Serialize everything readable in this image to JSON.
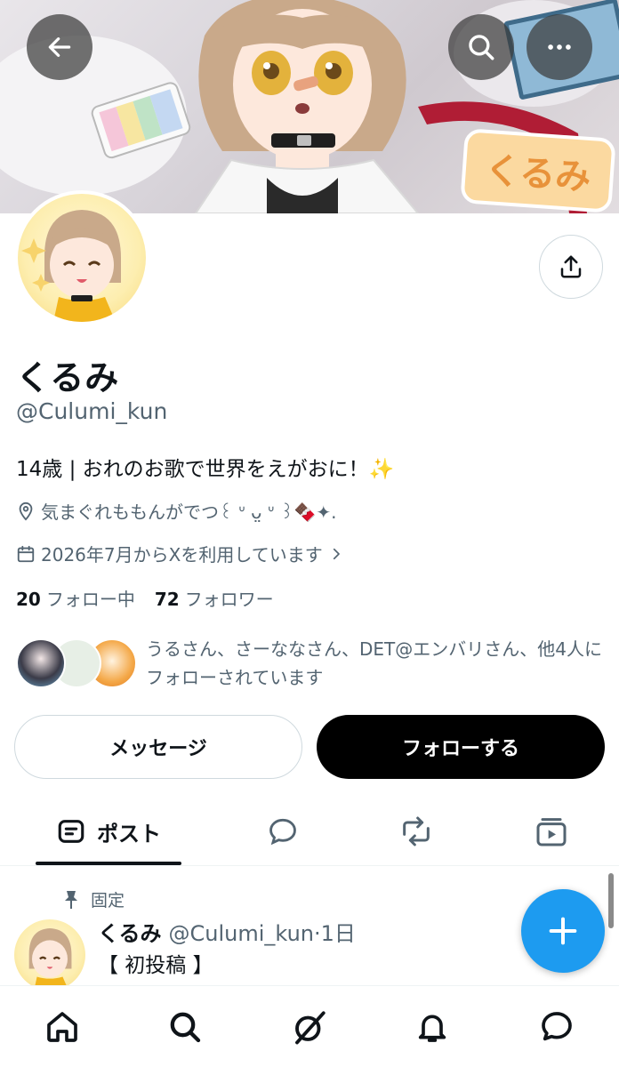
{
  "profile": {
    "display_name": "くるみ",
    "handle": "@Culumi_kun",
    "bio": "14歳 | おれのお歌で世界をえがおに！✨",
    "location": "気まぐれももんがでつ꒰ ᐡ ᴗ̤ ᐡ ꒱🍫✦.",
    "joined": "2026年7月からXを利用しています",
    "banner_logo_text": "くるみ"
  },
  "stats": {
    "following_count": "20",
    "following_label": "フォロー中",
    "followers_count": "72",
    "followers_label": "フォロワー"
  },
  "followed_by": {
    "text": "うるさん、さーななさん、DET@エンバリさん、他4人にフォローされています"
  },
  "actions": {
    "message_label": "メッセージ",
    "follow_label": "フォローする"
  },
  "tabs": {
    "posts_label": "ポスト"
  },
  "pinned_post": {
    "pinned_label": "固定",
    "author_name": "くるみ",
    "author_handle_time": "@Culumi_kun·1日",
    "text": "【 初投稿 】"
  },
  "colors": {
    "accent": "#1d9bf0",
    "text_primary": "#0f1419",
    "text_secondary": "#536471"
  },
  "icons": {
    "back": "back-arrow-icon",
    "search": "search-icon",
    "more": "more-icon",
    "share": "share-icon",
    "location": "location-pin-icon",
    "calendar": "calendar-icon",
    "compose": "plus-icon"
  }
}
